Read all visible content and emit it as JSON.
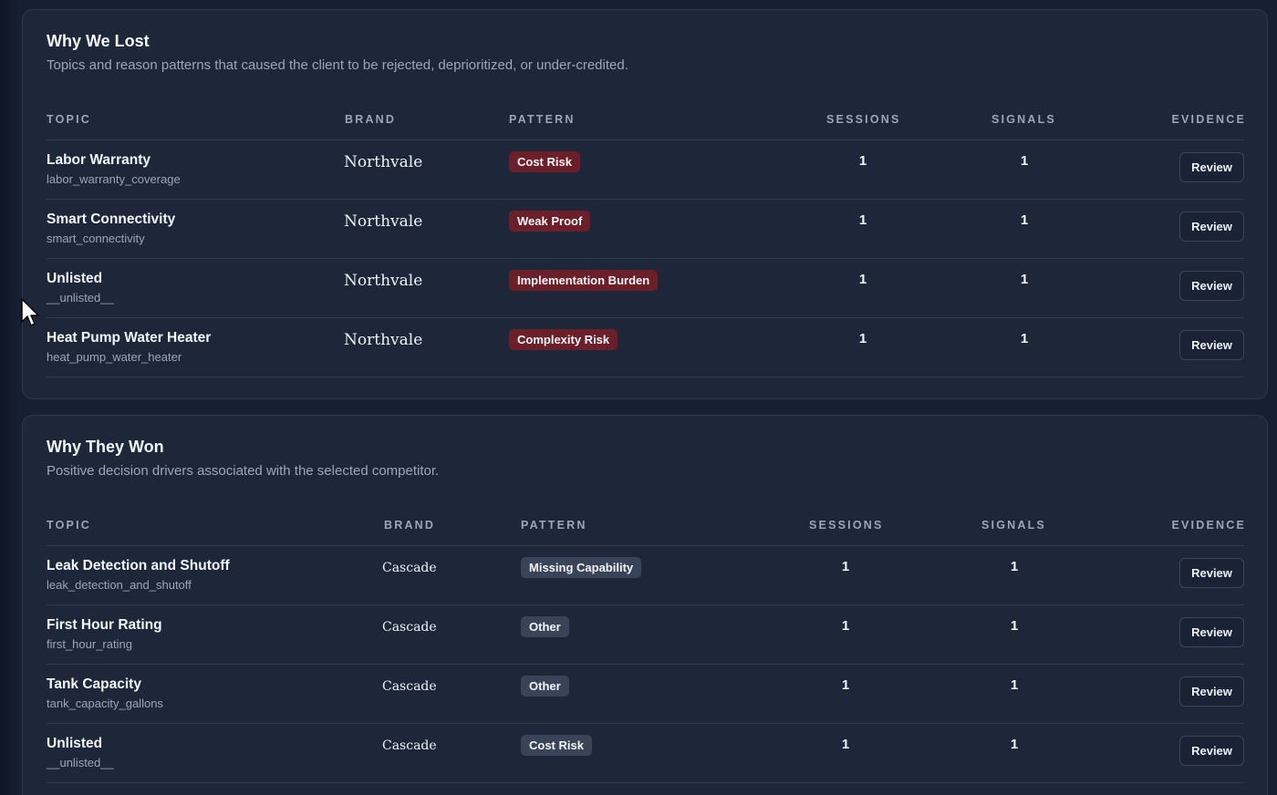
{
  "lost": {
    "title": "Why We Lost",
    "subtitle": "Topics and reason patterns that caused the client to be rejected, deprioritized, or under-credited.",
    "headers": {
      "topic": "TOPIC",
      "brand": "BRAND",
      "pattern": "PATTERN",
      "sessions": "SESSIONS",
      "signals": "SIGNALS",
      "evidence": "EVIDENCE"
    },
    "rows": [
      {
        "topic": "Labor Warranty",
        "key": "labor_warranty_coverage",
        "brand": "Northvale",
        "pattern": "Cost Risk",
        "sessions": "1",
        "signals": "1",
        "action": "Review"
      },
      {
        "topic": "Smart Connectivity",
        "key": "smart_connectivity",
        "brand": "Northvale",
        "pattern": "Weak Proof",
        "sessions": "1",
        "signals": "1",
        "action": "Review"
      },
      {
        "topic": "Unlisted",
        "key": "__unlisted__",
        "brand": "Northvale",
        "pattern": "Implementation Burden",
        "sessions": "1",
        "signals": "1",
        "action": "Review"
      },
      {
        "topic": "Heat Pump Water Heater",
        "key": "heat_pump_water_heater",
        "brand": "Northvale",
        "pattern": "Complexity Risk",
        "sessions": "1",
        "signals": "1",
        "action": "Review"
      }
    ]
  },
  "won": {
    "title": "Why They Won",
    "subtitle": "Positive decision drivers associated with the selected competitor.",
    "headers": {
      "topic": "TOPIC",
      "brand": "BRAND",
      "pattern": "PATTERN",
      "sessions": "SESSIONS",
      "signals": "SIGNALS",
      "evidence": "EVIDENCE"
    },
    "rows": [
      {
        "topic": "Leak Detection and Shutoff",
        "key": "leak_detection_and_shutoff",
        "brand": "Cascade",
        "pattern": "Missing Capability",
        "sessions": "1",
        "signals": "1",
        "action": "Review"
      },
      {
        "topic": "First Hour Rating",
        "key": "first_hour_rating",
        "brand": "Cascade",
        "pattern": "Other",
        "sessions": "1",
        "signals": "1",
        "action": "Review"
      },
      {
        "topic": "Tank Capacity",
        "key": "tank_capacity_gallons",
        "brand": "Cascade",
        "pattern": "Other",
        "sessions": "1",
        "signals": "1",
        "action": "Review"
      },
      {
        "topic": "Unlisted",
        "key": "__unlisted__",
        "brand": "Cascade",
        "pattern": "Cost Risk",
        "sessions": "1",
        "signals": "1",
        "action": "Review"
      }
    ]
  },
  "colors": {
    "background": "#172033",
    "card": "#1d2739",
    "risk_pill": "#6b1f29",
    "neutral_pill": "#3a4459",
    "muted_text": "#9aa6ba"
  },
  "icons": {
    "cursor": "mouse-pointer-icon"
  }
}
